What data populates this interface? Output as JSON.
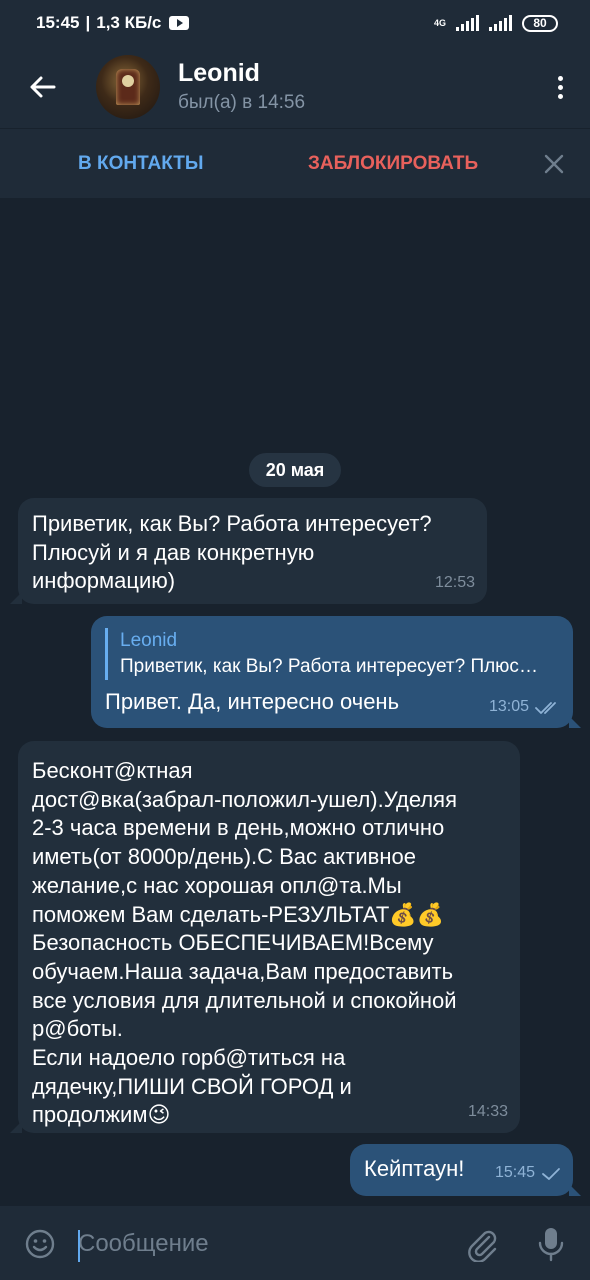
{
  "status_bar": {
    "time": "15:45",
    "separator": "|",
    "speed": "1,3 КБ/с",
    "network": "4G",
    "battery": "80"
  },
  "header": {
    "contact_name": "Leonid",
    "last_seen": "был(а) в 14:56"
  },
  "action_bar": {
    "add_contact_label": "В КОНТАКТЫ",
    "block_label": "ЗАБЛОКИРОВАТЬ"
  },
  "chat": {
    "date_label": "20 мая",
    "messages": [
      {
        "direction": "incoming",
        "text": "Приветик, как Вы? Работа интересует?\nПлюсуй и я дав конкретную\nинформацию)",
        "time": "12:53"
      },
      {
        "direction": "outgoing",
        "reply_to_name": "Leonid",
        "reply_to_text": "Приветик, как Вы? Работа интересует? Плюсуй и я дав конкретную информацию)",
        "text": "Привет. Да, интересно очень",
        "time": "13:05",
        "status": "read"
      },
      {
        "direction": "incoming",
        "text": "Бесконт@ктная\nдост@вка(забрал-положил-ушел).Уделяя\n2-3 часа времени в день,можно отлично\nиметь(от 8000р/день).С Вас активное\nжелание,с нас хорошая опл@та.Мы\nпоможем Вам сделать-РЕЗУЛЬТАТ💰💰\nБезопасность ОБЕСПЕЧИВАЕМ!Всему\nобучаем.Наша задача,Вам предоставить\nвсе условия для длительной и спокойной\nр@боты.\nЕсли надоело горб@титься на\nдядечку,ПИШИ СВОЙ ГОРОД и\nпродолжим😉",
        "time": "14:33"
      },
      {
        "direction": "outgoing",
        "text": "Кейптаун!",
        "time": "15:45",
        "status": "sent"
      }
    ]
  },
  "input": {
    "placeholder": "Сообщение",
    "value": ""
  },
  "colors": {
    "chat_background": "#18222d",
    "header_background": "#1f2b38",
    "incoming_bubble": "#222f3c",
    "outgoing_bubble": "#2b5278",
    "accent_blue": "#62a9ee",
    "accent_red": "#e8615c"
  },
  "icons": {
    "back": "arrow-left-icon",
    "menu": "more-vertical-icon",
    "close": "close-icon",
    "emoji": "smile-icon",
    "attach": "paperclip-icon",
    "mic": "microphone-icon",
    "read_receipt": "double-check-icon",
    "sent_receipt": "single-check-icon"
  }
}
